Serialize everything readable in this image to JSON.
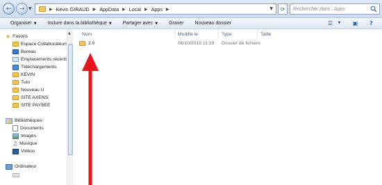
{
  "address_bar": {
    "path": [
      "Kevin GIRAUD",
      "AppData",
      "Local",
      "Apps"
    ],
    "search_placeholder": "Rechercher dans : Apps"
  },
  "toolbar": {
    "organize": "Organiser",
    "include": "Inclure dans la bibliothèque",
    "share": "Partager avec",
    "burn": "Graver",
    "new_folder": "Nouveau dossier"
  },
  "navigation": {
    "favorites_label": "Favoris",
    "favorites": [
      {
        "label": "Espace Collaborateurs",
        "icon": "folder-icon"
      },
      {
        "label": "Bureau",
        "icon": "desktop-icon"
      },
      {
        "label": "Emplacements récents",
        "icon": "recent-places-icon"
      },
      {
        "label": "Téléchargements",
        "icon": "downloads-icon"
      },
      {
        "label": "KEVIN",
        "icon": "folder-icon"
      },
      {
        "label": "Tuto",
        "icon": "folder-icon"
      },
      {
        "label": "Nouveau U",
        "icon": "folder-icon"
      },
      {
        "label": "SITE AXENS",
        "icon": "folder-icon"
      },
      {
        "label": "SITE PAYBEE",
        "icon": "folder-icon"
      }
    ],
    "libraries_label": "Bibliothèques",
    "libraries": [
      {
        "label": "Documents",
        "icon": "documents-icon"
      },
      {
        "label": "Images",
        "icon": "pictures-icon"
      },
      {
        "label": "Musique",
        "icon": "music-icon"
      },
      {
        "label": "Vidéos",
        "icon": "videos-icon"
      }
    ],
    "computer_label": "Ordinateur"
  },
  "columns": {
    "name": "Nom",
    "modified": "Modifié le",
    "type": "Type",
    "size": "Taille"
  },
  "files": [
    {
      "name": "2.0",
      "modified": "06/10/2015 11:29",
      "type": "Dossier de fichiers",
      "size": ""
    }
  ],
  "colors": {
    "arrow": "#e8131b",
    "folder": "#f0c45a",
    "toolbar_top": "#f4f8fc",
    "toolbar_bottom": "#dde8f4"
  }
}
